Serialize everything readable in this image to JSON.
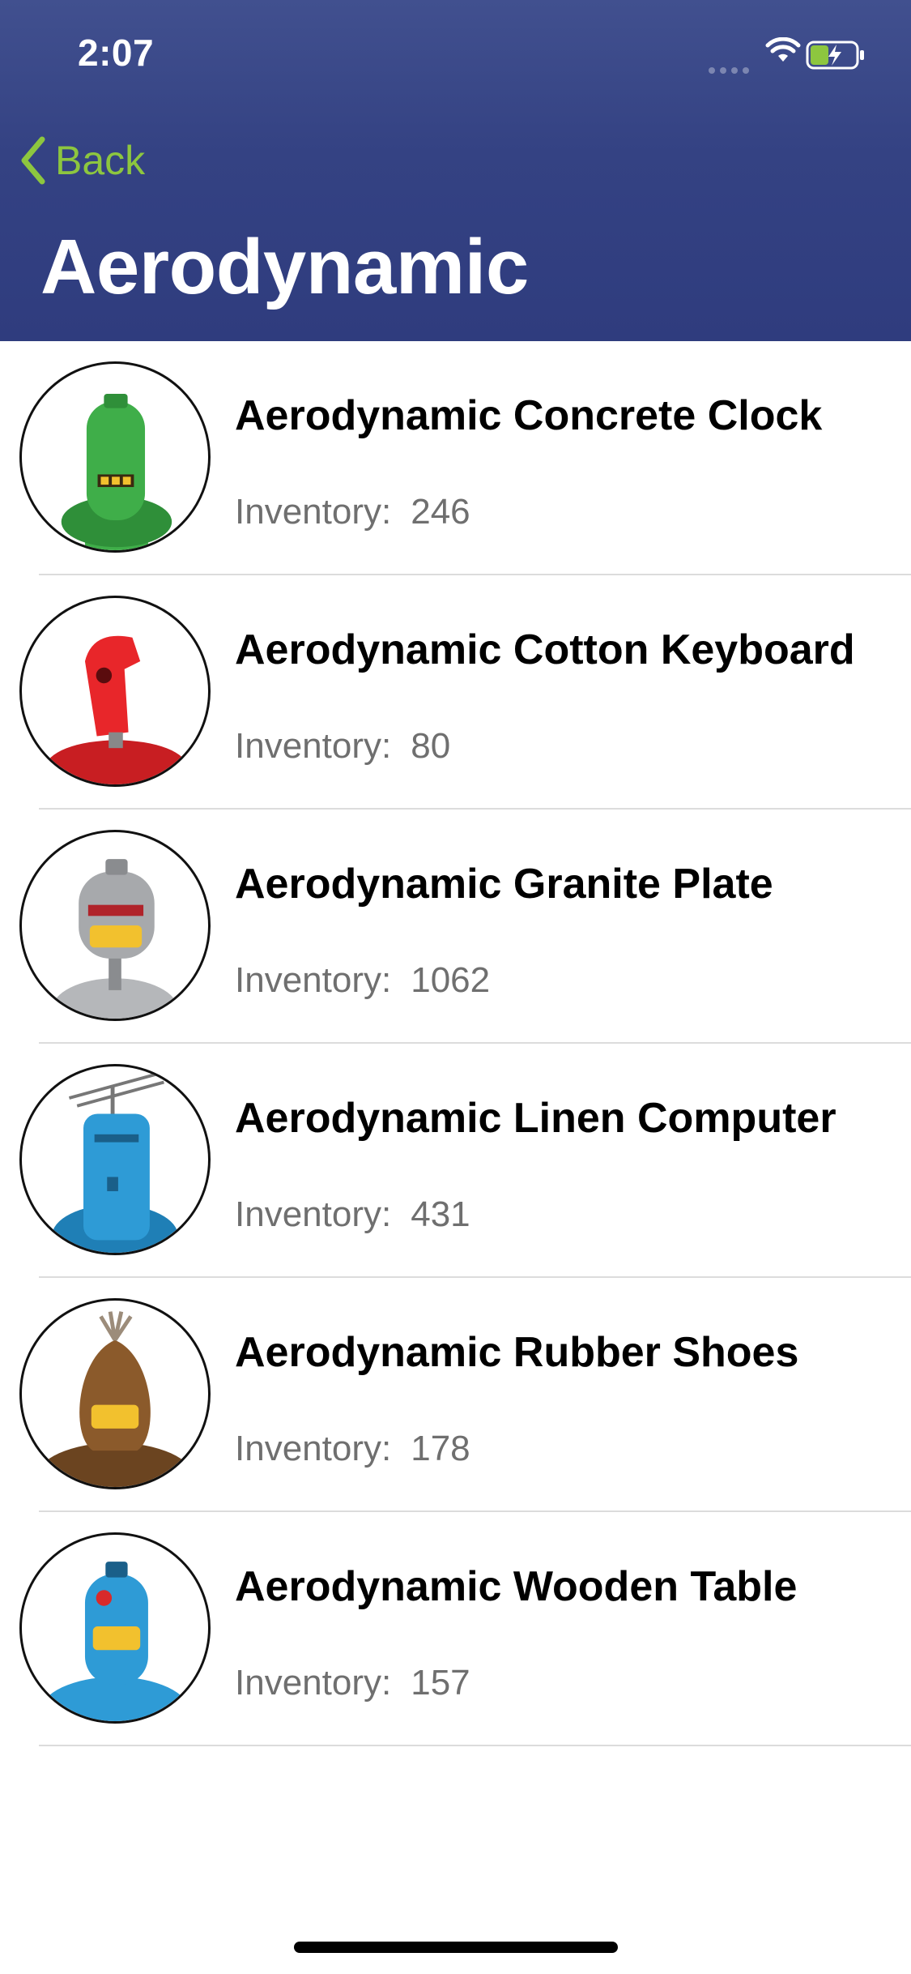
{
  "status_bar": {
    "time": "2:07"
  },
  "nav": {
    "back_label": "Back",
    "title": "Aerodynamic"
  },
  "products": [
    {
      "name": "Aerodynamic Concrete Clock",
      "inventory_label": "Inventory:",
      "inventory": "246",
      "color": "#3fae49"
    },
    {
      "name": "Aerodynamic Cotton Keyboard",
      "inventory_label": "Inventory:",
      "inventory": "80",
      "color": "#e8262a"
    },
    {
      "name": "Aerodynamic Granite Plate",
      "inventory_label": "Inventory:",
      "inventory": "1062",
      "color": "#a7a9ac"
    },
    {
      "name": "Aerodynamic Linen Computer",
      "inventory_label": "Inventory:",
      "inventory": "431",
      "color": "#2e9bd6"
    },
    {
      "name": "Aerodynamic Rubber Shoes",
      "inventory_label": "Inventory:",
      "inventory": "178",
      "color": "#8b5a2b"
    },
    {
      "name": "Aerodynamic Wooden Table",
      "inventory_label": "Inventory:",
      "inventory": "157",
      "color": "#2e9bd6"
    }
  ],
  "colors": {
    "header": "#344283",
    "accent": "#8dc63f"
  },
  "icons": [
    "wifi-icon",
    "battery-charging-icon",
    "chevron-left-icon",
    "robot-avatar-icon"
  ]
}
